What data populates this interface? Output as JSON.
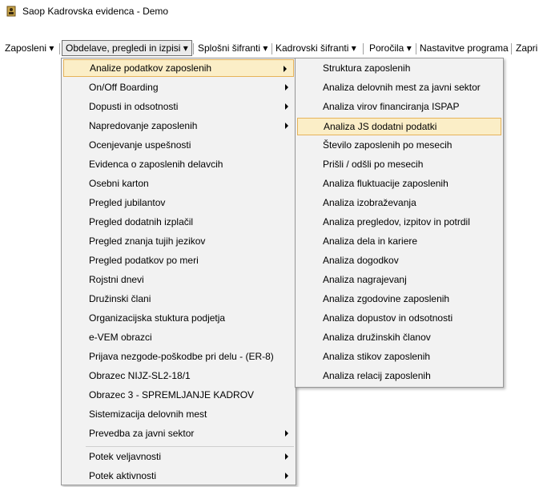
{
  "window": {
    "title": "Saop Kadrovska evidenca  - Demo"
  },
  "menubar": [
    {
      "label": "Zaposleni"
    },
    {
      "label": "Obdelave, pregledi in izpisi"
    },
    {
      "label": "Splošni šifranti"
    },
    {
      "label": "Kadrovski šifranti"
    },
    {
      "label": "Poročila"
    },
    {
      "label": "Nastavitve programa"
    },
    {
      "label": "Zapri"
    }
  ],
  "main_menu": [
    {
      "label": "Analize podatkov zaposlenih"
    },
    {
      "label": "On/Off Boarding"
    },
    {
      "label": "Dopusti in odsotnosti"
    },
    {
      "label": "Napredovanje zaposlenih"
    },
    {
      "label": "Ocenjevanje uspešnosti"
    },
    {
      "label": "Evidenca o zaposlenih delavcih"
    },
    {
      "label": "Osebni karton"
    },
    {
      "label": "Pregled jubilantov"
    },
    {
      "label": "Pregled dodatnih izplačil"
    },
    {
      "label": "Pregled znanja tujih jezikov"
    },
    {
      "label": "Pregled podatkov po meri"
    },
    {
      "label": "Rojstni dnevi"
    },
    {
      "label": "Družinski člani"
    },
    {
      "label": "Organizacijska stuktura podjetja"
    },
    {
      "label": "e-VEM obrazci"
    },
    {
      "label": "Prijava nezgode-poškodbe pri delu - (ER-8)"
    },
    {
      "label": "Obrazec NIJZ-SL2-18/1"
    },
    {
      "label": "Obrazec 3 - SPREMLJANJE KADROV"
    },
    {
      "label": "Sistemizacija delovnih mest"
    },
    {
      "label": "Prevedba za javni sektor"
    },
    {
      "label": "Potek veljavnosti"
    },
    {
      "label": "Potek aktivnosti"
    }
  ],
  "sub_menu": [
    {
      "label": "Struktura zaposlenih"
    },
    {
      "label": "Analiza delovnih mest za javni sektor"
    },
    {
      "label": "Analiza virov financiranja ISPAP"
    },
    {
      "label": "Analiza JS dodatni podatki"
    },
    {
      "label": "Število zaposlenih po mesecih"
    },
    {
      "label": "Prišli / odšli po mesecih"
    },
    {
      "label": "Analiza fluktuacije zaposlenih"
    },
    {
      "label": "Analiza izobraževanja"
    },
    {
      "label": "Analiza pregledov, izpitov in potrdil"
    },
    {
      "label": "Analiza dela in kariere"
    },
    {
      "label": "Analiza dogodkov"
    },
    {
      "label": "Analiza nagrajevanj"
    },
    {
      "label": "Analiza zgodovine zaposlenih"
    },
    {
      "label": "Analiza dopustov in odsotnosti"
    },
    {
      "label": "Analiza družinskih članov"
    },
    {
      "label": "Analiza stikov zaposlenih"
    },
    {
      "label": "Analiza relacij zaposlenih"
    }
  ],
  "colors": {
    "highlight_bg": "#fbeec7",
    "highlight_border": "#e6b35a",
    "menu_bg": "#f2f2f2"
  }
}
